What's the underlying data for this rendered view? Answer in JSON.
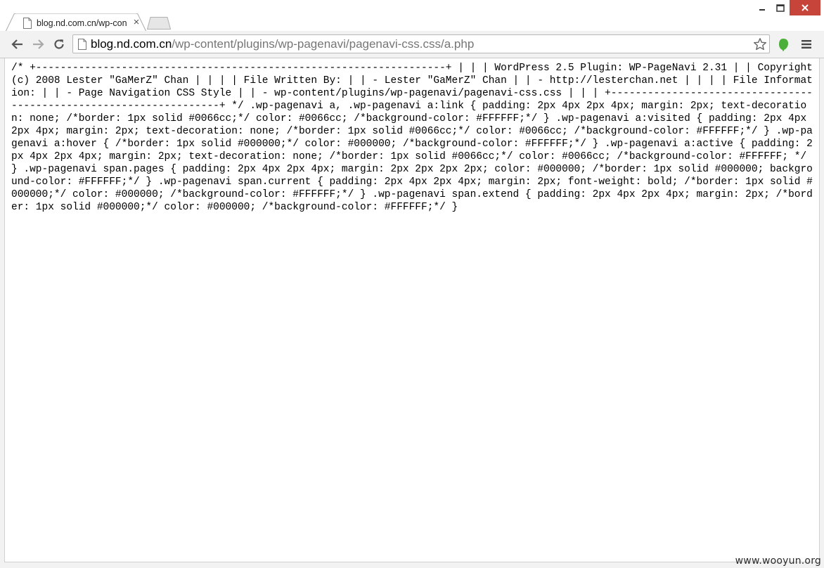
{
  "browser": {
    "tab": {
      "title": "blog.nd.com.cn/wp-con",
      "close_glyph": "×",
      "icon": "page-icon"
    },
    "window_controls": {
      "minimize_icon": "minimize-icon",
      "maximize_icon": "maximize-icon",
      "close_icon": "close-icon"
    },
    "toolbar": {
      "back_icon": "back-arrow-icon",
      "forward_icon": "forward-arrow-icon",
      "reload_icon": "reload-icon",
      "bookmark_icon": "star-icon",
      "extension_icon": "evernote-icon",
      "menu_icon": "hamburger-menu-icon"
    },
    "address_bar": {
      "host": "blog.nd.com.cn",
      "path": "/wp-content/plugins/wp-pagenavi/pagenavi-css.css/a.php"
    }
  },
  "page": {
    "text": "/* +-------------------------------------------------------------------+ | | | WordPress 2.5 Plugin: WP-PageNavi 2.31 | | Copyright (c) 2008 Lester \"GaMerZ\" Chan | | | | File Written By: | | - Lester \"GaMerZ\" Chan | | - http://lesterchan.net | | | | File Information: | | - Page Navigation CSS Style | | - wp-content/plugins/wp-pagenavi/pagenavi-css.css | | | +-------------------------------------------------------------------+ */ .wp-pagenavi a, .wp-pagenavi a:link { padding: 2px 4px 2px 4px; margin: 2px; text-decoration: none; /*border: 1px solid #0066cc;*/ color: #0066cc; /*background-color: #FFFFFF;*/ } .wp-pagenavi a:visited { padding: 2px 4px 2px 4px; margin: 2px; text-decoration: none; /*border: 1px solid #0066cc;*/ color: #0066cc; /*background-color: #FFFFFF;*/ } .wp-pagenavi a:hover { /*border: 1px solid #000000;*/ color: #000000; /*background-color: #FFFFFF;*/ } .wp-pagenavi a:active { padding: 2px 4px 2px 4px; margin: 2px; text-decoration: none; /*border: 1px solid #0066cc;*/ color: #0066cc; /*background-color: #FFFFFF; */ } .wp-pagenavi span.pages { padding: 2px 4px 2px 4px; margin: 2px 2px 2px 2px; color: #000000; /*border: 1px solid #000000; background-color: #FFFFFF;*/ } .wp-pagenavi span.current { padding: 2px 4px 2px 4px; margin: 2px; font-weight: bold; /*border: 1px solid #000000;*/ color: #000000; /*background-color: #FFFFFF;*/ } .wp-pagenavi span.extend { padding: 2px 4px 2px 4px; margin: 2px; /*border: 1px solid #000000;*/ color: #000000; /*background-color: #FFFFFF;*/ }"
  },
  "watermark": {
    "text": "www.wooyun.org"
  },
  "colors": {
    "window_close": "#c7443a",
    "extension_green": "#4caf3a",
    "url_host": "#000000",
    "url_path": "#767676"
  }
}
